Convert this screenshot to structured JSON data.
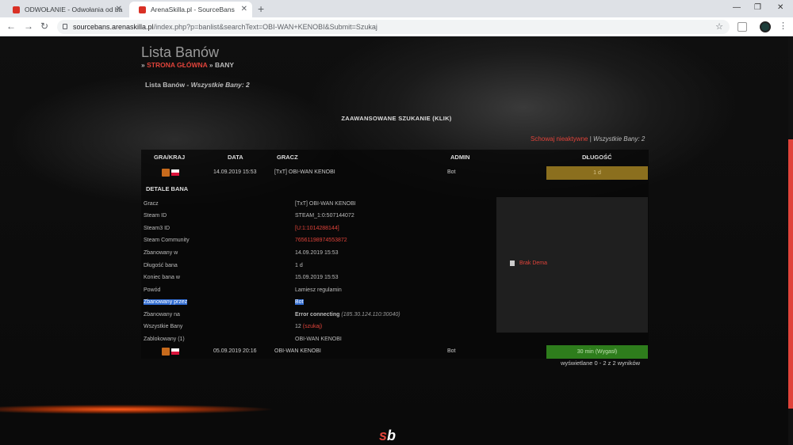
{
  "browser": {
    "tabs": [
      {
        "title": "ODWOŁANIE - Odwołania od ba"
      },
      {
        "title": "ArenaSkilla.pl - SourceBans"
      }
    ],
    "url_host": "sourcebans.arenaskilla.pl",
    "url_rest": "/index.php?p=banlist&searchText=OBI-WAN+KENOBI&Submit=Szukaj"
  },
  "page": {
    "title": "Lista Banów",
    "breadcrumb": {
      "sep": "»",
      "home": "STRONA GŁÓWNA",
      "current": "BANY"
    },
    "subheader": {
      "title": "Lista Banów",
      "rest": " - Wszystkie Bany: 2"
    },
    "advanced_search": "ZAAWANSOWANE SZUKANIE (KLIK)",
    "hide_inactive": "Schowaj nieaktywne",
    "all_bans": "Wszystkie Bany: 2",
    "results": "wyświetlane 0 - 2 z 2 wyników"
  },
  "table": {
    "headers": {
      "game": "GRA/KRAJ",
      "date": "DATA",
      "player": "GRACZ",
      "admin": "ADMIN",
      "length": "DŁUGOŚĆ"
    },
    "rows": [
      {
        "date": "14.09.2019 15:53",
        "player": "[TxT] OBI-WAN KENOBI",
        "admin": "Bot",
        "length": "1 d",
        "length_color": "#8b6f1e"
      },
      {
        "date": "05.09.2019 20:16",
        "player": "OBI-WAN KENOBI",
        "admin": "Bot",
        "length": "30 min (Wygasł)",
        "length_color": "#2e7d1c"
      }
    ]
  },
  "details": {
    "header": "DETALE BANA",
    "labels": {
      "player": "Gracz",
      "steam_id": "Steam ID",
      "steam3_id": "Steam3 ID",
      "community": "Steam Community",
      "banned_on": "Zbanowany w",
      "length": "Długość bana",
      "end": "Koniec bana w",
      "reason": "Powód",
      "banned_by": "Zbanowany przez",
      "server": "Zbanowany na",
      "all_bans": "Wszystkie Bany",
      "blocked": "Zablokowany (1)"
    },
    "values": {
      "player": "[TxT] OBI-WAN KENOBI",
      "steam_id": "STEAM_1:0:507144072",
      "steam3_id": "[U:1:1014288144]",
      "community": "76561198974553872",
      "banned_on": "14.09.2019 15:53",
      "length": "1 d",
      "end": "15.09.2019 15:53",
      "reason": "Lamiesz regulamin",
      "banned_by": "Bot",
      "server_bold": "Error connecting",
      "server_ip": "(185.30.124.110:30040)",
      "all_bans_count": "12",
      "all_bans_link": "(szukaj)",
      "blocked": "OBI-WAN KENOBI"
    },
    "demo": "Brak Dema"
  },
  "colors": {
    "accent": "#e0433a"
  }
}
